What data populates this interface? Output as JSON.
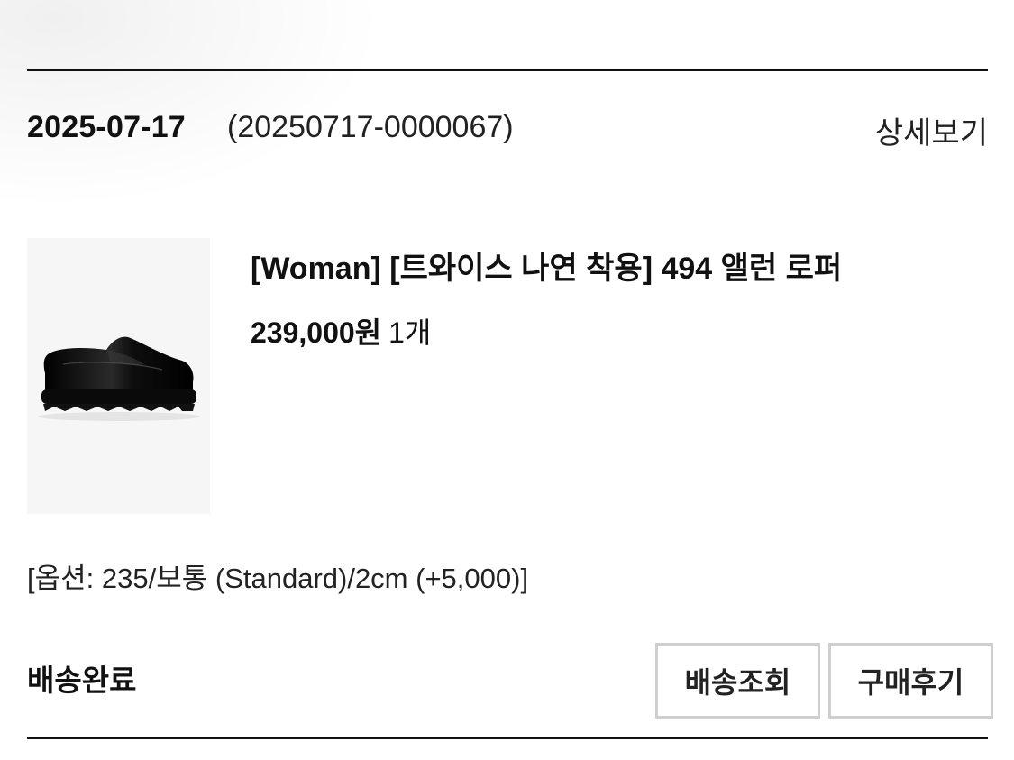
{
  "order": {
    "date": "2025-07-17",
    "number": "(20250717-0000067)",
    "detail_label": "상세보기"
  },
  "product": {
    "image_icon": "black-loafer-shoe",
    "name": "[Woman] [트와이스 나연 착용] 494 앨런 로퍼",
    "price": "239,000원",
    "quantity": "1개",
    "option": "[옵션: 235/보통 (Standard)/2cm (+5,000)]"
  },
  "shipping": {
    "status": "배송완료",
    "track_label": "배송조회",
    "review_label": "구매후기"
  }
}
